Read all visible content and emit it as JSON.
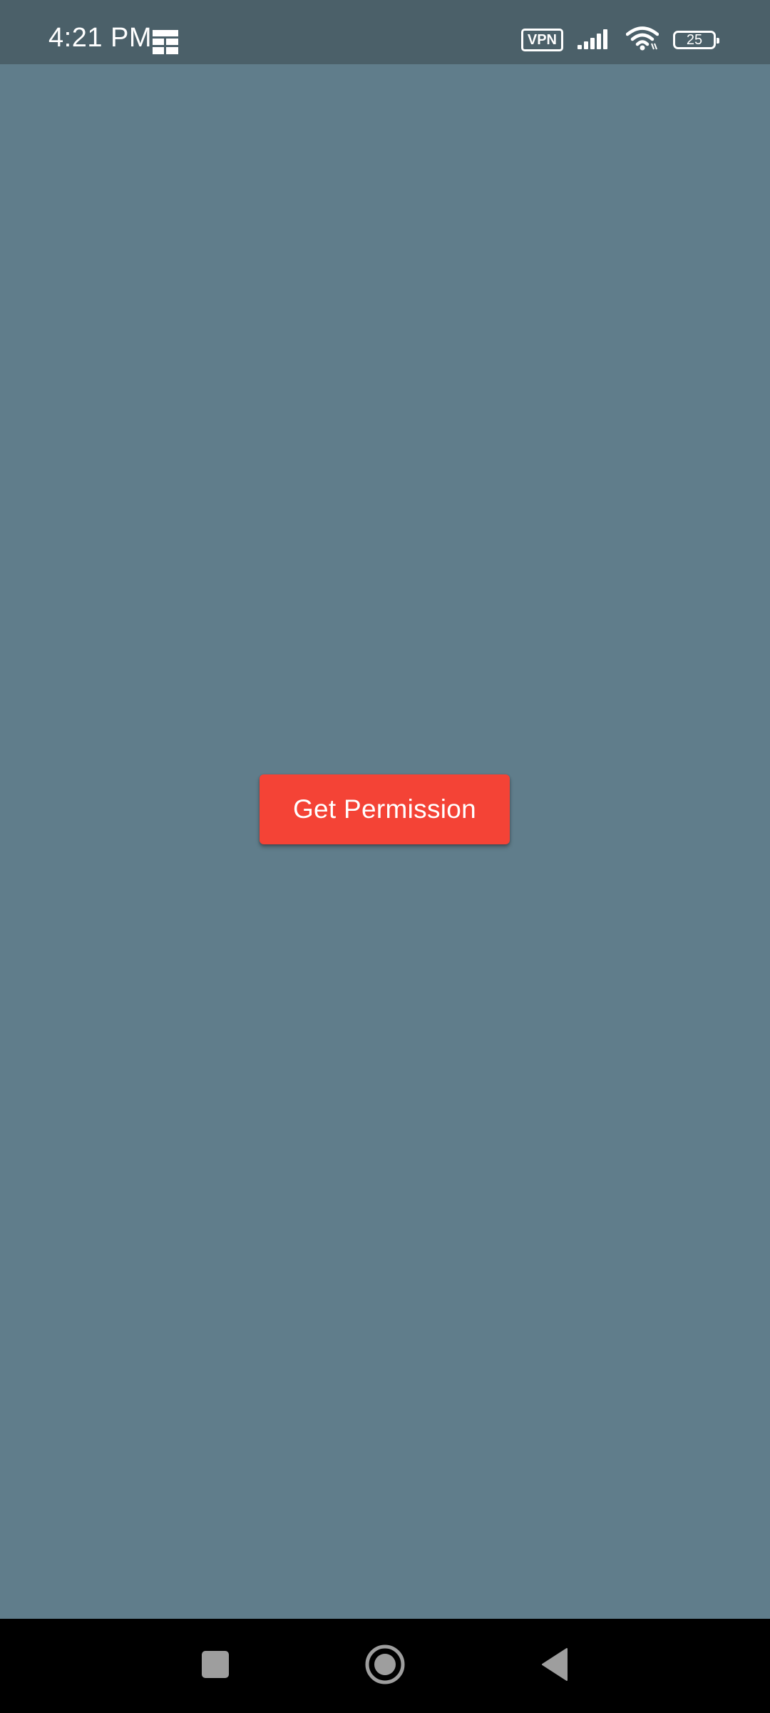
{
  "status_bar": {
    "time": "4:21 PM",
    "notification_icon": "grid-app-icon",
    "vpn_label": "VPN",
    "signal_icon": "cellular-signal-icon",
    "wifi_icon": "wifi-icon",
    "battery_level": "25"
  },
  "main": {
    "button_label": "Get Permission",
    "background_color": "#607d8b",
    "button_color": "#f44336"
  },
  "nav_bar": {
    "recents_icon": "square-recents-icon",
    "home_icon": "circle-home-icon",
    "back_icon": "triangle-back-icon"
  }
}
